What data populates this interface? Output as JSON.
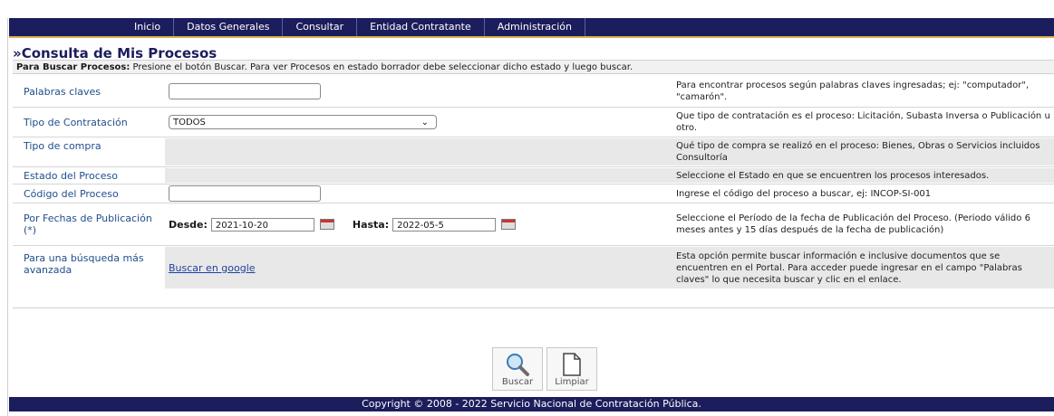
{
  "nav": {
    "items": [
      "Inicio",
      "Datos Generales",
      "Consultar",
      "Entidad Contratante",
      "Administración"
    ]
  },
  "page": {
    "title": "»Consulta de Mis Procesos",
    "instructions_bold": "Para Buscar Procesos:",
    "instructions_text": " Presione el botón Buscar. Para ver Procesos en estado borrador debe seleccionar dicho estado y luego buscar."
  },
  "form": {
    "palabras": {
      "label": "Palabras claves",
      "value": "",
      "help": "Para encontrar procesos según palabras claves ingresadas; ej: \"computador\", \"camarón\"."
    },
    "tipo_contratacion": {
      "label": "Tipo de Contratación",
      "selected": "TODOS",
      "help": "Que tipo de contratación es el proceso: Licitación, Subasta Inversa o Publicación u otro."
    },
    "tipo_compra": {
      "label": "Tipo de compra",
      "help": "Qué tipo de compra se realizó en el proceso: Bienes, Obras o Servicios incluidos Consultoría"
    },
    "estado": {
      "label": "Estado del Proceso",
      "help": "Seleccione el Estado en que se encuentren los procesos interesados."
    },
    "codigo": {
      "label": "Código del Proceso",
      "value": "",
      "help": "Ingrese el código del proceso a buscar, ej: INCOP-SI-001"
    },
    "fechas": {
      "label": "Por Fechas de Publicación (*)",
      "desde_label": "Desde:",
      "desde_value": "2021-10-20",
      "hasta_label": "Hasta:",
      "hasta_value": "2022-05-5",
      "help": "Seleccione el Período de la fecha de Publicación del Proceso. (Periodo válido 6 meses antes y 15 días después de la fecha de publicación)"
    },
    "avanzada": {
      "label": "Para una búsqueda más avanzada",
      "link": "Buscar en google",
      "help": "Esta opción permite buscar información e inclusive documentos que se encuentren en el Portal. Para acceder puede ingresar en el campo \"Palabras claves\" lo que necesita buscar y clic en el enlace."
    }
  },
  "buttons": {
    "buscar": "Buscar",
    "limpiar": "Limpiar"
  },
  "footer": {
    "text": "Copyright © 2008 - 2022 Servicio Nacional de Contratación Pública."
  }
}
